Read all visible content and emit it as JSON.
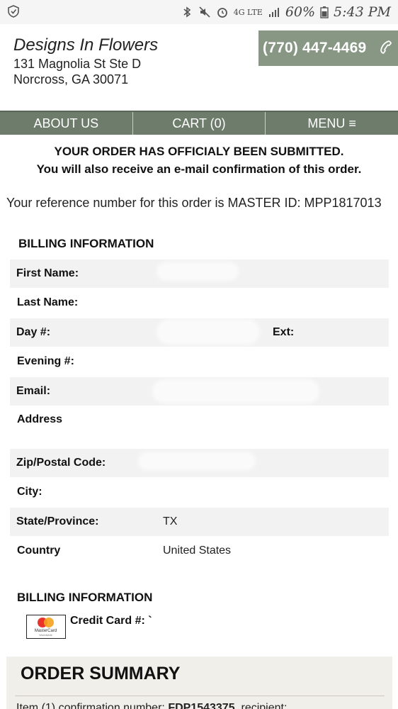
{
  "status_bar": {
    "battery": "60%",
    "time": "5:43 PM",
    "network": "4G LTE"
  },
  "header": {
    "business_name": "Designs In Flowers",
    "address_line1": "131 Magnolia St Ste D",
    "address_line2": "Norcross, GA 30071",
    "phone": "(770) 447-4469"
  },
  "nav": {
    "about": "ABOUT US",
    "cart": "CART (0)",
    "menu": "MENU ≡"
  },
  "confirmation": {
    "line1": "YOUR ORDER HAS OFFICIALY BEEN SUBMITTED.",
    "line2": "You will also receive an e-mail confirmation of this order.",
    "reference": "Your reference number for this order is MASTER ID: MPP1817013"
  },
  "billing": {
    "heading": "BILLING INFORMATION",
    "first_name_label": "First Name:",
    "last_name_label": "Last Name:",
    "day_label": "Day #:",
    "ext_label": "Ext:",
    "evening_label": "Evening #:",
    "email_label": "Email:",
    "address_label": "Address",
    "zip_label": "Zip/Postal Code:",
    "city_label": "City:",
    "state_label": "State/Province:",
    "state_value": "TX",
    "country_label": "Country",
    "country_value": "United States"
  },
  "payment": {
    "heading": "BILLING INFORMATION",
    "card_label": "Credit Card #:",
    "card_value": "`",
    "card_brand": "MasterCard",
    "card_brand_sub": "Worldwide"
  },
  "summary": {
    "title": "ORDER SUMMARY",
    "line_prefix": "Item (1) confirmation number:",
    "line_number": "FDP1543375",
    "line_suffix": ", recipient:"
  },
  "colors": {
    "accent": "#889784",
    "nav": "#6e7c6c",
    "summary_bg": "#f1efe9",
    "row_shade": "#f2f2f2"
  }
}
